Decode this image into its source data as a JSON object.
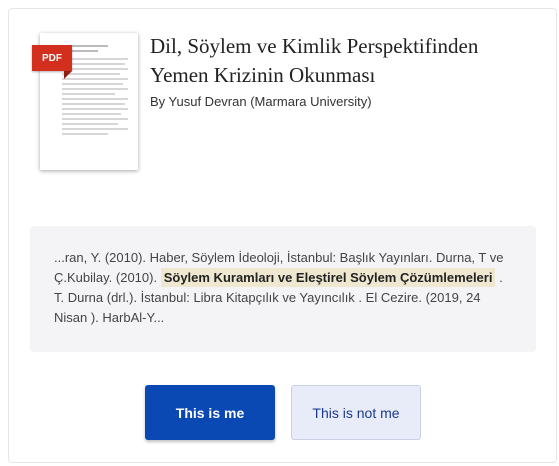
{
  "paper": {
    "badge": "PDF",
    "title": "Dil, Söylem ve Kimlik Perspektifinden Yemen Krizinin Okunması",
    "byline": "By Yusuf Devran (Marmara University)"
  },
  "snippet": {
    "before": "...ran, Y. (2010). Haber, Söylem İdeoloji, İstanbul: Başlık Yayınları. Durna, T ve Ç.Kubilay. (2010). ",
    "highlight": "Söylem Kuramları ve Eleştirel Söylem Çözümlemeleri",
    "after": " . T. Durna (drl.). İstanbul: Libra Kitapçılık ve Yayıncılık . El Cezire. (2019, 24 Nisan ). HarbAl-Y..."
  },
  "actions": {
    "confirm_label": "This is me",
    "reject_label": "This is not me"
  },
  "colors": {
    "primary": "#0a49b4",
    "pdf_badge": "#d32f1e",
    "highlight": "#efe7cf"
  }
}
